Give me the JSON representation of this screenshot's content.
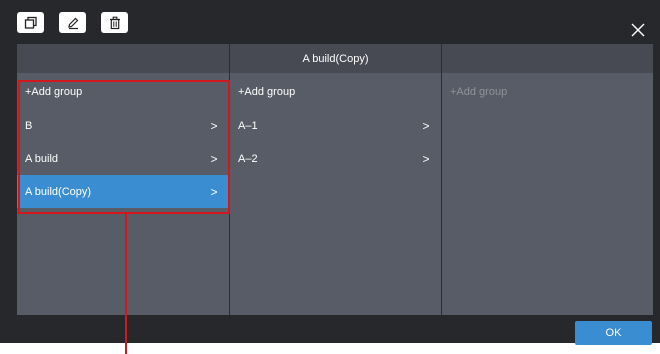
{
  "toolbar": {
    "icons": [
      "copy-icon",
      "edit-icon",
      "delete-icon"
    ]
  },
  "columns": [
    {
      "header": "",
      "items": [
        {
          "label": "+Add group",
          "chevron": ""
        },
        {
          "label": "B",
          "chevron": ">"
        },
        {
          "label": "A build",
          "chevron": ">"
        },
        {
          "label": "A build(Copy)",
          "chevron": ">",
          "selected": true
        }
      ]
    },
    {
      "header": "A build(Copy)",
      "items": [
        {
          "label": "+Add group",
          "chevron": ""
        },
        {
          "label": "A–1",
          "chevron": ">"
        },
        {
          "label": "A–2",
          "chevron": ">"
        }
      ]
    },
    {
      "header": "",
      "items": [
        {
          "label": "+Add group",
          "chevron": "",
          "placeholder": true
        }
      ]
    }
  ],
  "footer": {
    "ok_label": "OK"
  },
  "colors": {
    "accent": "#3a8dd1",
    "highlight": "#d4161e",
    "background": "#26282c",
    "column": "#585c66"
  }
}
